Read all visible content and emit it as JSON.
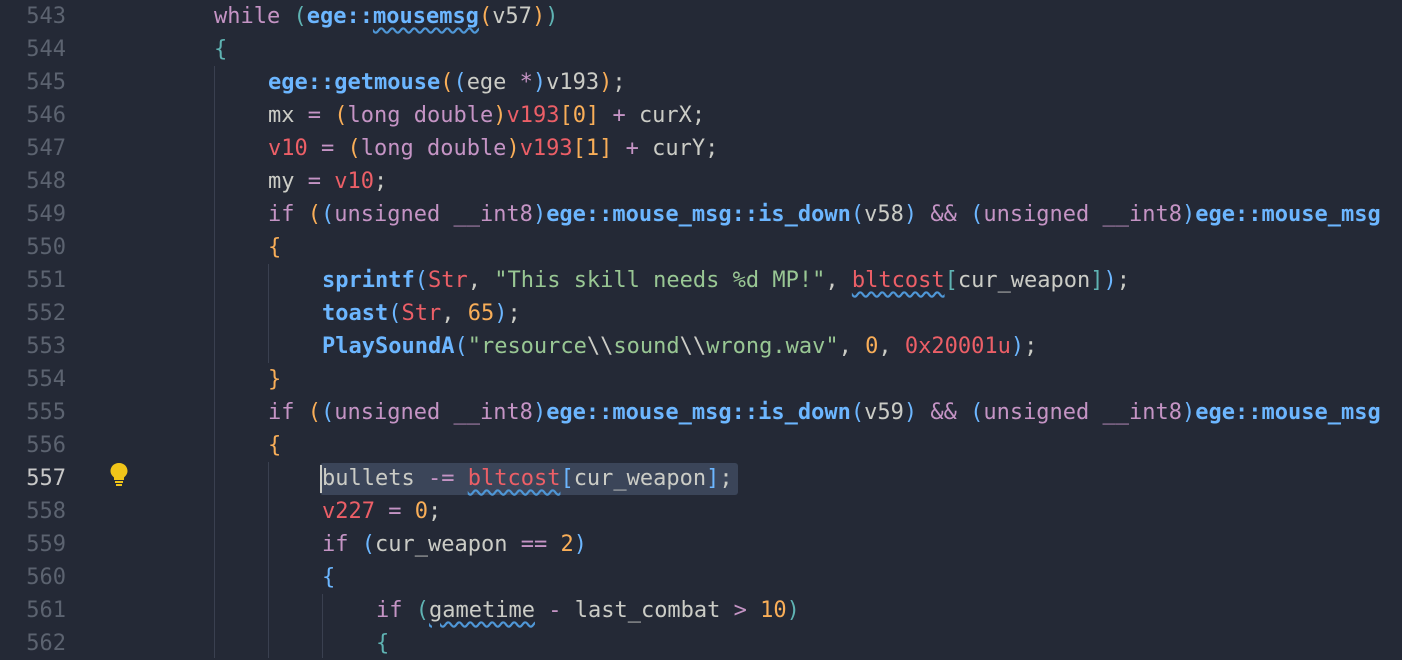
{
  "editor": {
    "line_numbers": [
      "543",
      "544",
      "545",
      "546",
      "547",
      "548",
      "549",
      "550",
      "551",
      "552",
      "553",
      "554",
      "555",
      "556",
      "557",
      "558",
      "559",
      "560",
      "561",
      "562"
    ],
    "active_line": "557"
  },
  "lines": [
    [
      {
        "t": "while ",
        "c": "kw"
      },
      {
        "t": "(",
        "c": "br1"
      },
      {
        "t": "ege::",
        "c": "fn"
      },
      {
        "t": "mousemsg",
        "c": "fn wavy"
      },
      {
        "t": "(",
        "c": "br2"
      },
      {
        "t": "v57",
        "c": "pl"
      },
      {
        "t": ")",
        "c": "br2"
      },
      {
        "t": ")",
        "c": "br1"
      }
    ],
    [
      {
        "t": "{",
        "c": "br1"
      }
    ],
    [
      {
        "t": "ege::getmouse",
        "c": "fn"
      },
      {
        "t": "(",
        "c": "br2"
      },
      {
        "t": "(",
        "c": "br3"
      },
      {
        "t": "ege ",
        "c": "pl"
      },
      {
        "t": "*",
        "c": "op"
      },
      {
        "t": ")",
        "c": "br3"
      },
      {
        "t": "v193",
        "c": "pl"
      },
      {
        "t": ")",
        "c": "br2"
      },
      {
        "t": ";",
        "c": "pl"
      }
    ],
    [
      {
        "t": "mx ",
        "c": "pl"
      },
      {
        "t": "= ",
        "c": "op"
      },
      {
        "t": "(",
        "c": "br2"
      },
      {
        "t": "long double",
        "c": "ty"
      },
      {
        "t": ")",
        "c": "br2"
      },
      {
        "t": "v193",
        "c": "var"
      },
      {
        "t": "[",
        "c": "br2"
      },
      {
        "t": "0",
        "c": "num"
      },
      {
        "t": "] ",
        "c": "br2"
      },
      {
        "t": "+ ",
        "c": "op"
      },
      {
        "t": "curX;",
        "c": "pl"
      }
    ],
    [
      {
        "t": "v10 ",
        "c": "var"
      },
      {
        "t": "= ",
        "c": "op"
      },
      {
        "t": "(",
        "c": "br2"
      },
      {
        "t": "long double",
        "c": "ty"
      },
      {
        "t": ")",
        "c": "br2"
      },
      {
        "t": "v193",
        "c": "var"
      },
      {
        "t": "[",
        "c": "br2"
      },
      {
        "t": "1",
        "c": "num"
      },
      {
        "t": "] ",
        "c": "br2"
      },
      {
        "t": "+ ",
        "c": "op"
      },
      {
        "t": "curY;",
        "c": "pl"
      }
    ],
    [
      {
        "t": "my ",
        "c": "pl"
      },
      {
        "t": "= ",
        "c": "op"
      },
      {
        "t": "v10",
        "c": "var"
      },
      {
        "t": ";",
        "c": "pl"
      }
    ],
    [
      {
        "t": "if ",
        "c": "kw"
      },
      {
        "t": "(",
        "c": "br2"
      },
      {
        "t": "(",
        "c": "br3"
      },
      {
        "t": "unsigned __int8",
        "c": "ty"
      },
      {
        "t": ")",
        "c": "br3"
      },
      {
        "t": "ege::mouse_msg::is_down",
        "c": "fn"
      },
      {
        "t": "(",
        "c": "br3"
      },
      {
        "t": "v58",
        "c": "pl"
      },
      {
        "t": ") ",
        "c": "br3"
      },
      {
        "t": "&& ",
        "c": "op"
      },
      {
        "t": "(",
        "c": "br3"
      },
      {
        "t": "unsigned __int8",
        "c": "ty"
      },
      {
        "t": ")",
        "c": "br3"
      },
      {
        "t": "ege::mouse_msg",
        "c": "fn"
      }
    ],
    [
      {
        "t": "{",
        "c": "br2"
      }
    ],
    [
      {
        "t": "sprintf",
        "c": "fn"
      },
      {
        "t": "(",
        "c": "br3"
      },
      {
        "t": "Str",
        "c": "var"
      },
      {
        "t": ", ",
        "c": "pl"
      },
      {
        "t": "\"This skill needs %d MP!\"",
        "c": "str"
      },
      {
        "t": ", ",
        "c": "pl"
      },
      {
        "t": "bltcost",
        "c": "var wavy"
      },
      {
        "t": "[",
        "c": "br1"
      },
      {
        "t": "cur_weapon",
        "c": "pl"
      },
      {
        "t": "]",
        "c": "br1"
      },
      {
        "t": ")",
        "c": "br3"
      },
      {
        "t": ";",
        "c": "pl"
      }
    ],
    [
      {
        "t": "toast",
        "c": "fn"
      },
      {
        "t": "(",
        "c": "br3"
      },
      {
        "t": "Str",
        "c": "var"
      },
      {
        "t": ", ",
        "c": "pl"
      },
      {
        "t": "65",
        "c": "num"
      },
      {
        "t": ")",
        "c": "br3"
      },
      {
        "t": ";",
        "c": "pl"
      }
    ],
    [
      {
        "t": "PlaySoundA",
        "c": "fn"
      },
      {
        "t": "(",
        "c": "br3"
      },
      {
        "t": "\"resource",
        "c": "str"
      },
      {
        "t": "\\\\",
        "c": "pl"
      },
      {
        "t": "sound",
        "c": "str"
      },
      {
        "t": "\\\\",
        "c": "pl"
      },
      {
        "t": "wrong.wav\"",
        "c": "str"
      },
      {
        "t": ", ",
        "c": "pl"
      },
      {
        "t": "0",
        "c": "num"
      },
      {
        "t": ", ",
        "c": "pl"
      },
      {
        "t": "0x20001u",
        "c": "var"
      },
      {
        "t": ")",
        "c": "br3"
      },
      {
        "t": ";",
        "c": "pl"
      }
    ],
    [
      {
        "t": "}",
        "c": "br2"
      }
    ],
    [
      {
        "t": "if ",
        "c": "kw"
      },
      {
        "t": "(",
        "c": "br2"
      },
      {
        "t": "(",
        "c": "br3"
      },
      {
        "t": "unsigned __int8",
        "c": "ty"
      },
      {
        "t": ")",
        "c": "br3"
      },
      {
        "t": "ege::mouse_msg::is_down",
        "c": "fn"
      },
      {
        "t": "(",
        "c": "br3"
      },
      {
        "t": "v59",
        "c": "pl"
      },
      {
        "t": ") ",
        "c": "br3"
      },
      {
        "t": "&& ",
        "c": "op"
      },
      {
        "t": "(",
        "c": "br3"
      },
      {
        "t": "unsigned __int8",
        "c": "ty"
      },
      {
        "t": ")",
        "c": "br3"
      },
      {
        "t": "ege::mouse_msg",
        "c": "fn"
      }
    ],
    [
      {
        "t": "{",
        "c": "br2"
      }
    ],
    [
      {
        "t": "bullets ",
        "c": "pl"
      },
      {
        "t": "-= ",
        "c": "op"
      },
      {
        "t": "bltcost",
        "c": "var wavy"
      },
      {
        "t": "[",
        "c": "br3"
      },
      {
        "t": "cur_weapon",
        "c": "pl"
      },
      {
        "t": "]",
        "c": "br3"
      },
      {
        "t": ";",
        "c": "pl"
      }
    ],
    [
      {
        "t": "v227 ",
        "c": "var"
      },
      {
        "t": "= ",
        "c": "op"
      },
      {
        "t": "0",
        "c": "num"
      },
      {
        "t": ";",
        "c": "pl"
      }
    ],
    [
      {
        "t": "if ",
        "c": "kw"
      },
      {
        "t": "(",
        "c": "br3"
      },
      {
        "t": "cur_weapon ",
        "c": "pl"
      },
      {
        "t": "== ",
        "c": "op"
      },
      {
        "t": "2",
        "c": "num"
      },
      {
        "t": ")",
        "c": "br3"
      }
    ],
    [
      {
        "t": "{",
        "c": "br3"
      }
    ],
    [
      {
        "t": "if ",
        "c": "kw"
      },
      {
        "t": "(",
        "c": "br1"
      },
      {
        "t": "gametime",
        "c": "pl wavy"
      },
      {
        "t": " - ",
        "c": "op"
      },
      {
        "t": "last_combat ",
        "c": "pl"
      },
      {
        "t": "> ",
        "c": "op"
      },
      {
        "t": "10",
        "c": "num"
      },
      {
        "t": ")",
        "c": "br1"
      }
    ],
    [
      {
        "t": "{",
        "c": "br1"
      }
    ]
  ],
  "icons": {
    "gutter": "lightbulb-icon"
  }
}
